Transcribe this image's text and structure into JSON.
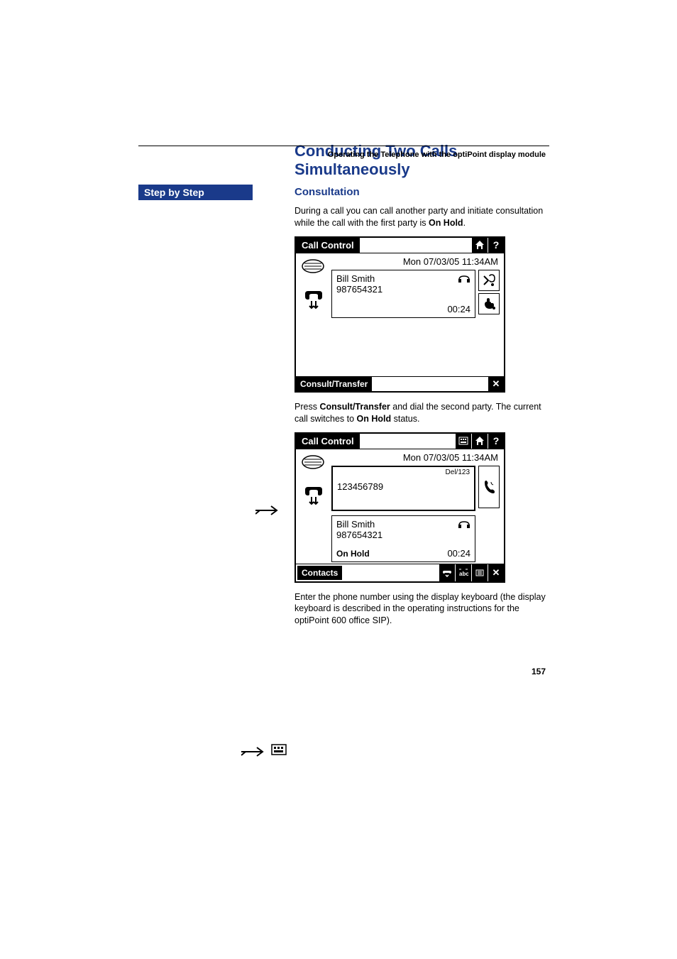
{
  "header": "Operating the Telephone with the optiPoint display module",
  "sidebar_label": "Step by Step",
  "section_title": "Conducting Two Calls Simultaneously",
  "subsection_title": "Consultation",
  "intro_para_1": "During a call you can call another party and initiate consultation while the call with the first party is ",
  "intro_bold_1": "On Hold",
  "intro_tail_1": ".",
  "screen1": {
    "title": "Call Control",
    "date": "Mon 07/03/05 11:34AM",
    "name": "Bill Smith",
    "number": "987654321",
    "timer": "00:24",
    "footer_btn": "Consult/Transfer"
  },
  "mid_para_pre": "Press ",
  "mid_para_bold": "Consult/Transfer",
  "mid_para_mid": " and dial the second party. The current call switches to ",
  "mid_para_bold2": "On Hold",
  "mid_para_tail": " status.",
  "screen2": {
    "title": "Call Control",
    "date": "Mon 07/03/05 11:34AM",
    "del_label": "Del/123",
    "dialed": "123456789",
    "name": "Bill Smith",
    "number": "987654321",
    "hold_label": "On Hold",
    "timer": "00:24",
    "footer_btn": "Contacts"
  },
  "end_para": "Enter the phone number using the display keyboard (the display keyboard is described in the operating instructions for the optiPoint 600 office SIP).",
  "page_number": "157"
}
